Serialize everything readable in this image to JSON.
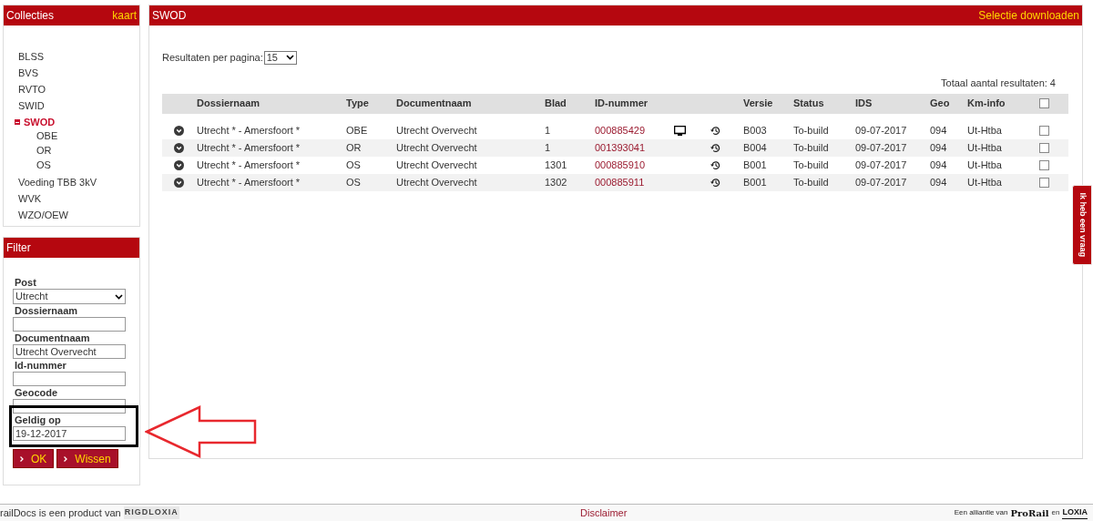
{
  "collections": {
    "title": "Collecties",
    "map_link": "kaart",
    "items": [
      {
        "label": "BLSS",
        "selected": false,
        "expanded": false
      },
      {
        "label": "BVS",
        "selected": false,
        "expanded": false
      },
      {
        "label": "RVTO",
        "selected": false,
        "expanded": false
      },
      {
        "label": "SWID",
        "selected": false,
        "expanded": false
      },
      {
        "label": "SWOD",
        "selected": true,
        "expanded": true,
        "children": [
          {
            "label": "OBE"
          },
          {
            "label": "OR"
          },
          {
            "label": "OS"
          }
        ]
      },
      {
        "label": "Voeding TBB 3kV",
        "selected": false,
        "expanded": false
      },
      {
        "label": "WVK",
        "selected": false,
        "expanded": false
      },
      {
        "label": "WZO/OEW",
        "selected": false,
        "expanded": false
      }
    ]
  },
  "filter": {
    "title": "Filter",
    "fields": [
      {
        "label": "Post",
        "kind": "select",
        "value": "Utrecht"
      },
      {
        "label": "Dossiernaam",
        "kind": "text"
      },
      {
        "label": "Documentnaam",
        "kind": "text",
        "value": "Utrecht Overvecht"
      },
      {
        "label": "Id-nummer",
        "kind": "text"
      },
      {
        "label": "Geocode",
        "kind": "text"
      },
      {
        "label": "Geldig op",
        "kind": "text",
        "value": "19-12-2017"
      }
    ],
    "buttons": [
      "OK",
      "Wissen"
    ]
  },
  "main": {
    "title": "SWOD",
    "download_link": "Selectie downloaden",
    "per_page_label": "Resultaten per pagina:",
    "per_page": "15",
    "total": "Totaal aantal resultaten: 4",
    "columns": [
      "Dossiernaam",
      "Type",
      "Documentnaam",
      "Blad",
      "ID-nummer",
      "Versie",
      "Status",
      "IDS",
      "Geo",
      "Km-info"
    ],
    "select_all": false,
    "rows": [
      {
        "dossiernaam": "Utrecht * - Amersfoort *",
        "type": "OBE",
        "documentnaam": "Utrecht Overvecht",
        "blad": "1",
        "id": "000885429",
        "viewer": true,
        "versie": "B003",
        "status": "To-build",
        "ids": "09-07-2017",
        "geo": "094",
        "km": "Ut-Htba",
        "checked": false
      },
      {
        "dossiernaam": "Utrecht * - Amersfoort *",
        "type": "OR",
        "documentnaam": "Utrecht Overvecht",
        "blad": "1",
        "id": "001393041",
        "viewer": false,
        "versie": "B004",
        "status": "To-build",
        "ids": "09-07-2017",
        "geo": "094",
        "km": "Ut-Htba",
        "checked": false
      },
      {
        "dossiernaam": "Utrecht * - Amersfoort *",
        "type": "OS",
        "documentnaam": "Utrecht Overvecht",
        "blad": "1301",
        "id": "000885910",
        "viewer": false,
        "versie": "B001",
        "status": "To-build",
        "ids": "09-07-2017",
        "geo": "094",
        "km": "Ut-Htba",
        "checked": false
      },
      {
        "dossiernaam": "Utrecht * - Amersfoort *",
        "type": "OS",
        "documentnaam": "Utrecht Overvecht",
        "blad": "1302",
        "id": "000885911",
        "viewer": false,
        "versie": "B001",
        "status": "To-build",
        "ids": "09-07-2017",
        "geo": "094",
        "km": "Ut-Htba",
        "checked": false
      }
    ]
  },
  "question_tab": "Ik heb een vraag",
  "footer": {
    "product": "railDocs is een product van",
    "product_logo": "RIGDLOXIA",
    "disclaimer": "Disclaimer",
    "alliance": "Een alliantie van",
    "logo_1": "ProRail",
    "and": "en",
    "logo_2": "LOXIA"
  }
}
